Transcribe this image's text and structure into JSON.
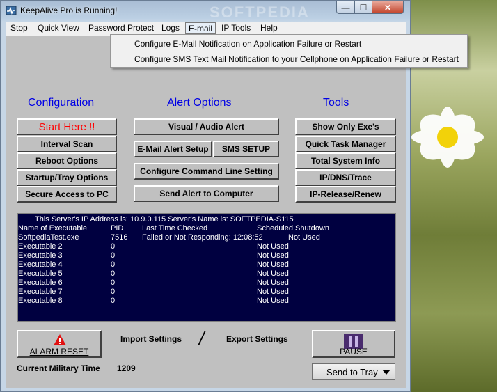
{
  "window": {
    "title": "KeepAlive Pro is Running!",
    "watermark": "SOFTPEDIA",
    "controls": {
      "minimize": "—",
      "maximize": "☐",
      "close": "✕"
    }
  },
  "menu": [
    {
      "label": "Stop"
    },
    {
      "label": "Quick View"
    },
    {
      "label": "Password Protect"
    },
    {
      "label": "Logs"
    },
    {
      "label": "E-mail"
    },
    {
      "label": "IP Tools"
    },
    {
      "label": "Help"
    }
  ],
  "email_menu": {
    "items": [
      "Configure E-Mail Notification on Application Failure or Restart",
      "Configure SMS Text Mail Notification to your Cellphone on Application Failure or Restart"
    ]
  },
  "sections": {
    "configuration": "Configuration",
    "alert_options": "Alert Options",
    "tools": "Tools"
  },
  "configuration_buttons": [
    "Start Here !!",
    "Interval Scan",
    "Reboot Options",
    "Startup/Tray Options",
    "Secure Access to PC"
  ],
  "alert_buttons": {
    "visual": "Visual / Audio Alert",
    "email_setup": "E-Mail Alert Setup",
    "sms_setup": "SMS SETUP",
    "command_line": "Configure Command Line Setting",
    "send_alert": "Send Alert to Computer"
  },
  "tools_buttons": [
    "Show Only Exe's",
    "Quick Task Manager",
    "Total System Info",
    "IP/DNS/Trace",
    "IP-Release/Renew"
  ],
  "status": {
    "server_line": "This Server's IP Address is: 10.9.0.115   Server's Name is: SOFTPEDIA-S115",
    "headers": {
      "name": "Name of Executable",
      "pid": "PID",
      "last_checked": "Last Time Checked",
      "shutdown": "Scheduled Shutdown"
    },
    "rows": [
      {
        "name": "SoftpediaTest.exe",
        "pid": "7516",
        "last": "Failed or Not Responding: 12:08:52",
        "shutdown": "Not Used"
      },
      {
        "name": "Executable 2",
        "pid": "0",
        "last": "",
        "shutdown": "Not Used"
      },
      {
        "name": "Executable 3",
        "pid": "0",
        "last": "",
        "shutdown": "Not Used"
      },
      {
        "name": "Executable 4",
        "pid": "0",
        "last": "",
        "shutdown": "Not Used"
      },
      {
        "name": "Executable 5",
        "pid": "0",
        "last": "",
        "shutdown": "Not Used"
      },
      {
        "name": "Executable 6",
        "pid": "0",
        "last": "",
        "shutdown": "Not Used"
      },
      {
        "name": "Executable 7",
        "pid": "0",
        "last": "",
        "shutdown": "Not Used"
      },
      {
        "name": "Executable 8",
        "pid": "0",
        "last": "",
        "shutdown": "Not Used"
      }
    ]
  },
  "footer": {
    "alarm_reset": "ALARM RESET",
    "import": "Import Settings",
    "slash": "/",
    "export": "Export Settings",
    "pause": "PAUSE",
    "military_label": "Current Military Time",
    "military_time": "1209",
    "send_to_tray": "Send to Tray"
  },
  "colors": {
    "heading": "#0000e6",
    "start_here": "#ff0000",
    "status_bg": "#000040",
    "client_bg": "#c0c0c0"
  }
}
